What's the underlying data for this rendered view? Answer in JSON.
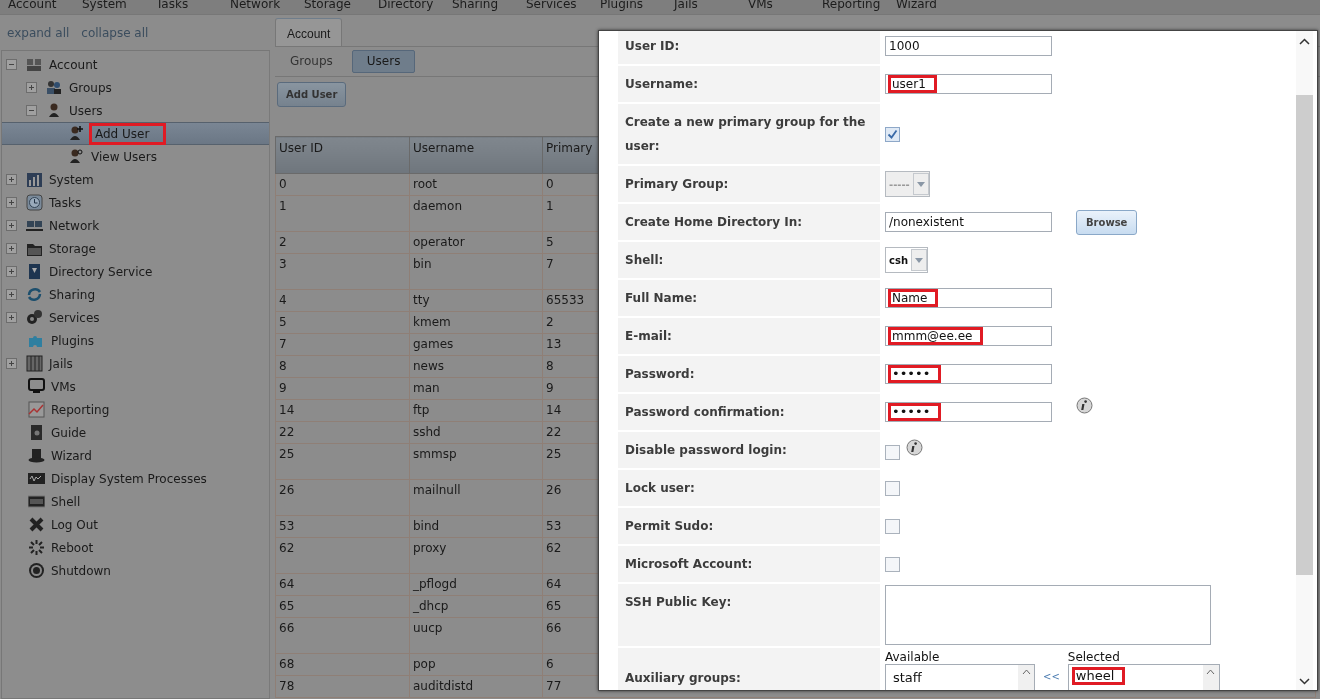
{
  "menu": [
    "Account",
    "System",
    "Tasks",
    "Network",
    "Storage",
    "Directory",
    "Sharing",
    "Services",
    "Plugins",
    "Jails",
    "VMs",
    "Reporting",
    "Wizard"
  ],
  "sidebar": {
    "links": [
      "expand all",
      "collapse all"
    ],
    "tree": [
      {
        "label": "Account",
        "expanded": true,
        "selected": false,
        "children": [
          {
            "label": "Groups",
            "expanded": false,
            "selected": false
          },
          {
            "label": "Users",
            "expanded": true,
            "selected": false,
            "children": [
              {
                "label": "Add User",
                "selected": true,
                "highlighted": true
              },
              {
                "label": "View Users",
                "selected": false
              }
            ]
          }
        ]
      },
      {
        "label": "System",
        "expanded": false,
        "selected": false
      },
      {
        "label": "Tasks",
        "expanded": false,
        "selected": false
      },
      {
        "label": "Network",
        "expanded": false,
        "selected": false
      },
      {
        "label": "Storage",
        "expanded": false,
        "selected": false
      },
      {
        "label": "Directory Service",
        "expanded": false,
        "selected": false
      },
      {
        "label": "Sharing",
        "expanded": false,
        "selected": false
      },
      {
        "label": "Services",
        "expanded": false,
        "selected": false
      },
      {
        "label": "Plugins",
        "selected": false
      },
      {
        "label": "Jails",
        "expanded": false,
        "selected": false
      },
      {
        "label": "VMs",
        "selected": false
      },
      {
        "label": "Reporting",
        "selected": false
      },
      {
        "label": "Guide",
        "selected": false
      },
      {
        "label": "Wizard",
        "selected": false
      },
      {
        "label": "Display System Processes",
        "selected": false
      },
      {
        "label": "Shell",
        "selected": false
      },
      {
        "label": "Log Out",
        "selected": false
      },
      {
        "label": "Reboot",
        "selected": false
      },
      {
        "label": "Shutdown",
        "selected": false
      }
    ]
  },
  "tabs": [
    {
      "label": "Account",
      "selected": true
    }
  ],
  "subtabs": [
    {
      "label": "Groups",
      "selected": false
    },
    {
      "label": "Users",
      "selected": true
    }
  ],
  "add_button": "Add User",
  "table": {
    "columns": [
      "User ID",
      "Username",
      "Primary"
    ],
    "rows": [
      {
        "kind": "single",
        "cells": [
          "0",
          "root",
          "0"
        ]
      },
      {
        "kind": "wrapped",
        "cells": [
          "1",
          "daemon",
          "1"
        ]
      },
      {
        "kind": "single",
        "cells": [
          "2",
          "operator",
          "5"
        ]
      },
      {
        "kind": "wrapped",
        "cells": [
          "3",
          "bin",
          "7"
        ]
      },
      {
        "kind": "single",
        "cells": [
          "4",
          "tty",
          "65533"
        ]
      },
      {
        "kind": "single",
        "cells": [
          "5",
          "kmem",
          "2"
        ]
      },
      {
        "kind": "single",
        "cells": [
          "7",
          "games",
          "13"
        ]
      },
      {
        "kind": "single",
        "cells": [
          "8",
          "news",
          "8"
        ]
      },
      {
        "kind": "single",
        "cells": [
          "9",
          "man",
          "9"
        ]
      },
      {
        "kind": "single",
        "cells": [
          "14",
          "ftp",
          "14"
        ]
      },
      {
        "kind": "single",
        "cells": [
          "22",
          "sshd",
          "22"
        ]
      },
      {
        "kind": "wrapped",
        "cells": [
          "25",
          "smmsp",
          "25"
        ]
      },
      {
        "kind": "wrapped",
        "cells": [
          "26",
          "mailnull",
          "26"
        ]
      },
      {
        "kind": "single",
        "cells": [
          "53",
          "bind",
          "53"
        ]
      },
      {
        "kind": "wrapped",
        "cells": [
          "62",
          "proxy",
          "62"
        ]
      },
      {
        "kind": "single",
        "cells": [
          "64",
          "_pflogd",
          "64"
        ]
      },
      {
        "kind": "single",
        "cells": [
          "65",
          "_dhcp",
          "65"
        ]
      },
      {
        "kind": "wrapped",
        "cells": [
          "66",
          "uucp",
          "66"
        ]
      },
      {
        "kind": "single",
        "cells": [
          "68",
          "pop",
          "6"
        ]
      },
      {
        "kind": "single",
        "cells": [
          "78",
          "auditdistd",
          "77"
        ]
      }
    ]
  },
  "dialog": {
    "fields": [
      {
        "kind": "text",
        "label": "User ID:",
        "value": "1000"
      },
      {
        "kind": "text",
        "label": "Username:",
        "value": "user1",
        "highlighted": true
      },
      {
        "kind": "checkbox",
        "label": "Create a new primary group for the user:",
        "checked": true
      },
      {
        "kind": "select",
        "label": "Primary Group:",
        "value": "-----",
        "disabled": true
      },
      {
        "kind": "text",
        "label": "Create Home Directory In:",
        "value": "/nonexistent",
        "button": "Browse"
      },
      {
        "kind": "select",
        "label": "Shell:",
        "value": "csh",
        "disabled": false
      },
      {
        "kind": "text",
        "label": "Full Name:",
        "value": "Name",
        "highlighted": true
      },
      {
        "kind": "text",
        "label": "E-mail:",
        "value": "mmm@ee.ee",
        "highlighted": true
      },
      {
        "kind": "password",
        "label": "Password:",
        "value": "•••••",
        "highlighted": true
      },
      {
        "kind": "password",
        "label": "Password confirmation:",
        "value": "•••••",
        "highlighted": true,
        "info": true
      },
      {
        "kind": "checkbox",
        "label": "Disable password login:",
        "checked": false,
        "info": true
      },
      {
        "kind": "checkbox",
        "label": "Lock user:",
        "checked": false
      },
      {
        "kind": "checkbox",
        "label": "Permit Sudo:",
        "checked": false
      },
      {
        "kind": "checkbox",
        "label": "Microsoft Account:",
        "checked": false
      },
      {
        "kind": "textarea",
        "label": "SSH Public Key:"
      },
      {
        "kind": "groups",
        "label": "Auxiliary groups:",
        "available_label": "Available",
        "selected_label": "Selected",
        "move_label": "<<",
        "available": [
          {
            "label": "staff"
          }
        ],
        "chosen": [
          {
            "label": "wheel",
            "highlighted": true
          }
        ]
      }
    ]
  }
}
